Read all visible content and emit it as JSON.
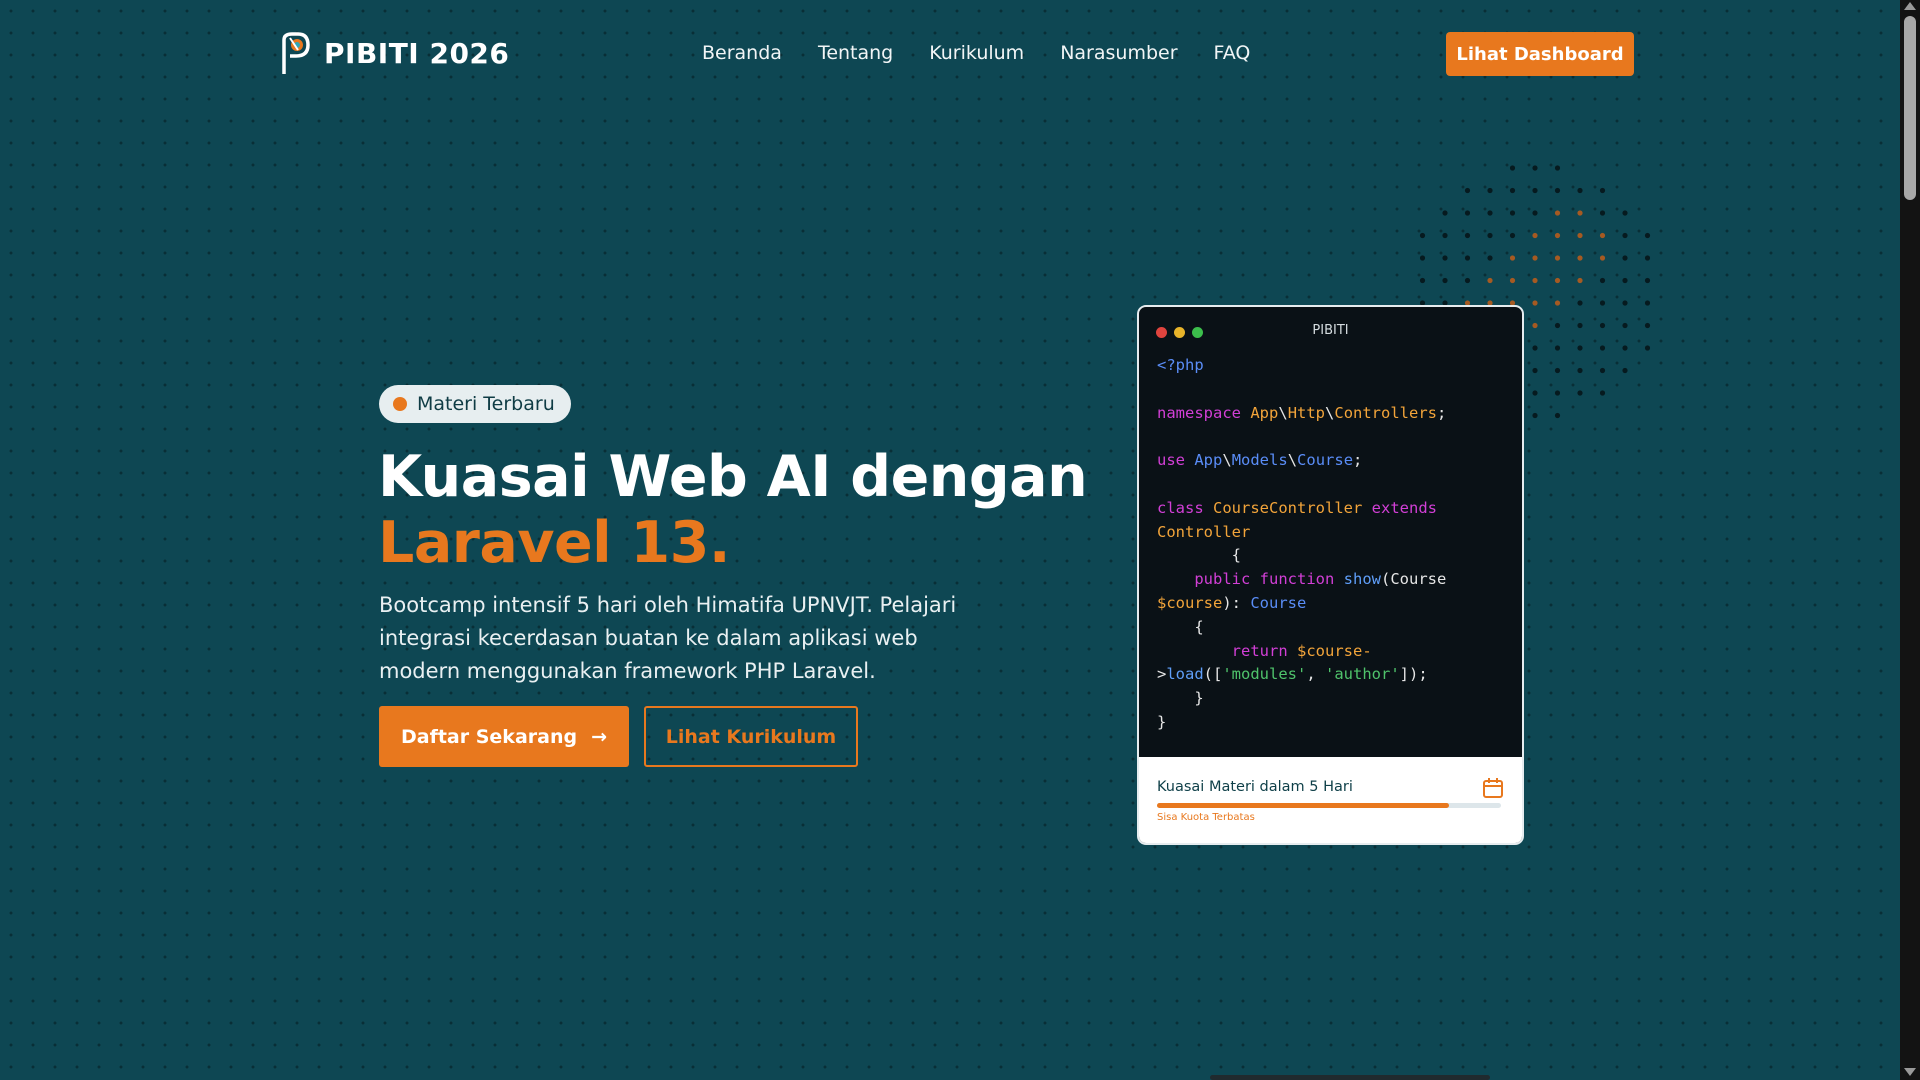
{
  "nav": {
    "brand": "PIBITI 2026",
    "links": [
      "Beranda",
      "Tentang",
      "Kurikulum",
      "Narasumber",
      "FAQ"
    ],
    "cta": "Lihat Dashboard"
  },
  "hero": {
    "badge": "Materi Terbaru",
    "title_line1": "Kuasai Web AI dengan",
    "title_line2": "Laravel 13.",
    "description": "Bootcamp intensif 5 hari oleh Himatifa UPNVJT. Pelajari integrasi kecerdasan buatan ke dalam aplikasi web modern menggunakan framework PHP Laravel.",
    "primary_button": "Daftar Sekarang",
    "primary_button_arrow": "→",
    "secondary_button": "Lihat Kurikulum"
  },
  "code_card": {
    "window_title": "PIBITI",
    "window_dots": [
      "#e0443e",
      "#e8b42a",
      "#3cbf4c"
    ],
    "code": {
      "open": "<?php",
      "ns_kw": "namespace",
      "ns_a": "App",
      "ns_b": "Http",
      "ns_c": "Controllers",
      "ns_end": ";",
      "use_kw": "use",
      "use_a": "App",
      "use_b": "Models",
      "use_c": "Course",
      "use_end": ";",
      "class_kw": "class",
      "class_name": "CourseController",
      "extends_kw": "extends",
      "parent": "Controller",
      "brace_open": "{",
      "public_kw": "public",
      "function_kw": "function",
      "fn_name": "show",
      "param_type": "(Course",
      "param_var": "$course",
      "param_close": "):",
      "return_type": "Course",
      "inner_open": "{",
      "return_kw": "return",
      "ret_var": "$course-",
      "arrow": ">",
      "load_fn": "load",
      "load_open": "([",
      "str1": "'modules'",
      "comma": ", ",
      "str2": "'author'",
      "load_close": "]);",
      "inner_close": "}",
      "brace_close": "}"
    },
    "progress": {
      "title": "Kuasai Materi dalam 5 Hari",
      "value": 0.85,
      "subtitle": "Sisa Kuota Terbatas",
      "icon": "calendar-icon"
    }
  },
  "colors": {
    "background": "#0e4753",
    "accent": "#e8781e"
  }
}
